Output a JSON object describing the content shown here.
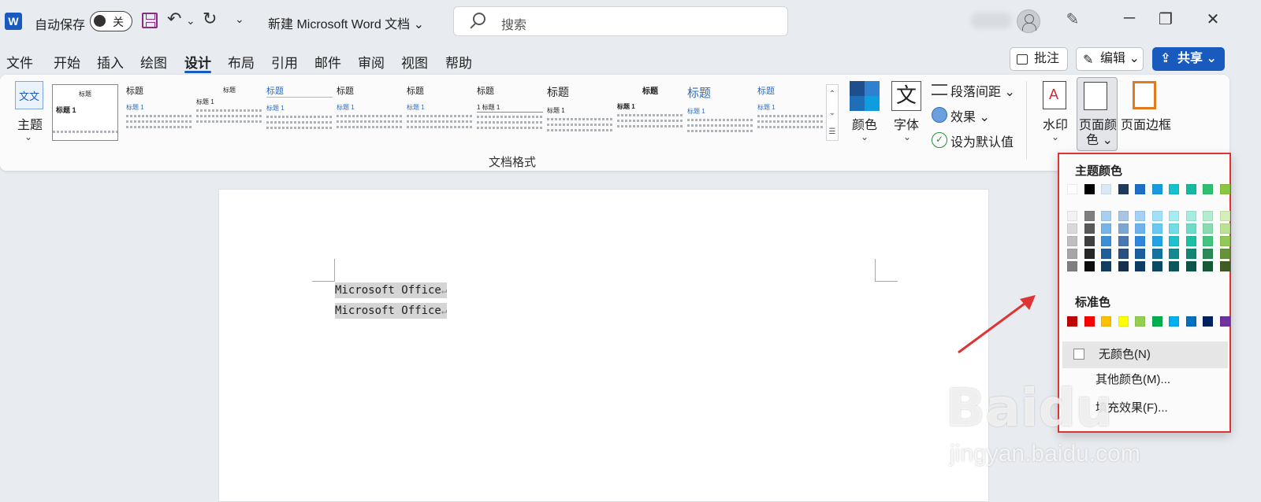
{
  "titlebar": {
    "app_logo": "W",
    "autosave_label": "自动保存",
    "autosave_state": "关",
    "save_icon": "save-icon",
    "undo_glyph": "↶",
    "undo_dropdown": "⌄",
    "redo_glyph": "↻",
    "customize_glyph": "⌄",
    "doc_title": "新建 Microsoft Word 文档 ⌄",
    "search_placeholder": "搜索",
    "window": {
      "minimize": "─",
      "restore": "❐",
      "close": "✕"
    },
    "coauthor_glyph": "✎"
  },
  "tabs": [
    "文件",
    "开始",
    "插入",
    "绘图",
    "设计",
    "布局",
    "引用",
    "邮件",
    "审阅",
    "视图",
    "帮助"
  ],
  "active_tab": "设计",
  "actions": {
    "comment": "批注",
    "edit": "编辑 ⌄",
    "share": "共享 ⌄"
  },
  "ribbon": {
    "theme": {
      "label": "主题",
      "chevron": "⌄",
      "icon_text": "文文"
    },
    "gallery": {
      "thumbs": [
        {
          "heading": "标题",
          "subheading": "标题 1"
        },
        {
          "heading": "标题",
          "subheading": "标题 1"
        },
        {
          "heading": "标题",
          "subheading": "标题 1"
        },
        {
          "heading": "标题",
          "subheading": "标题 1"
        },
        {
          "heading": "标题",
          "subheading": "标题 1"
        },
        {
          "heading": "标题",
          "subheading": "标题 1"
        },
        {
          "heading": "标题",
          "subheading": "1 标题 1"
        },
        {
          "heading": "标题",
          "subheading": "标题 1"
        },
        {
          "heading": "标题",
          "subheading": "标题 1"
        },
        {
          "heading": "标题",
          "subheading": "标题 1"
        },
        {
          "heading": "标题",
          "subheading": "标题 1"
        }
      ],
      "scroll": [
        "⌃",
        "⌄",
        "☰"
      ]
    },
    "group_label": "文档格式",
    "colors": {
      "label": "颜色",
      "chevron": "⌄"
    },
    "fonts": {
      "label": "字体",
      "icon_text": "文",
      "chevron": "⌄"
    },
    "paragraph_spacing": "段落间距 ⌄",
    "effects": "效果 ⌄",
    "set_default": "设为默认值",
    "watermark": {
      "label": "水印",
      "chevron": "⌄"
    },
    "page_color": {
      "label_top": "页面颜",
      "label_bottom": "色 ⌄"
    },
    "page_border": {
      "label": "页面边框"
    }
  },
  "document": {
    "lines": [
      "Microsoft Office",
      "Microsoft Office"
    ],
    "paragraph_mark": "↵"
  },
  "dropdown": {
    "theme_title": "主题颜色",
    "theme_top": [
      "#ffffff",
      "#000000",
      "#dbe9f7",
      "#1f3a5f",
      "#1e6fc4",
      "#1a9be0",
      "#14c2cc",
      "#15b8a0",
      "#2fbf71",
      "#8cc540"
    ],
    "theme_shades": [
      [
        "#f2f2f2",
        "#d9d9d9",
        "#bfbfbf",
        "#a6a6a6",
        "#7f7f7f"
      ],
      [
        "#7f7f7f",
        "#595959",
        "#3f3f3f",
        "#262626",
        "#0d0d0d"
      ],
      [
        "#a9cff0",
        "#77b5e8",
        "#3a8fd6",
        "#1f5f99",
        "#123d63"
      ],
      [
        "#a9c4e4",
        "#7ea6d4",
        "#4a77b4",
        "#2a4f80",
        "#17304f"
      ],
      [
        "#a6d0f5",
        "#6fb2ef",
        "#2f86dd",
        "#195e9e",
        "#0f3c66"
      ],
      [
        "#a2e0f8",
        "#69c9f1",
        "#23a3e3",
        "#14739f",
        "#0b4a67"
      ],
      [
        "#a6edf1",
        "#70dde4",
        "#1fc2cc",
        "#14898f",
        "#0b575c"
      ],
      [
        "#a4ede0",
        "#6dddc8",
        "#1bbfa2",
        "#128673",
        "#0a564a"
      ],
      [
        "#b5ebce",
        "#88dcb0",
        "#43c47f",
        "#2a8a58",
        "#175a38"
      ],
      [
        "#d7edba",
        "#bce094",
        "#93c854",
        "#65923a",
        "#3e5c23"
      ]
    ],
    "standard_title": "标准色",
    "standard": [
      "#c00000",
      "#ff0000",
      "#ffc000",
      "#ffff00",
      "#92d050",
      "#00b050",
      "#00b0f0",
      "#0070c0",
      "#002060",
      "#7030a0"
    ],
    "no_color": "无颜色(N)",
    "more_colors": "其他颜色(M)...",
    "fill_effects": "填充效果(F)..."
  },
  "watermark_overlay": {
    "brand": "Baidu",
    "url": "jingyan.baidu.com"
  },
  "accent_color": "#185abd",
  "highlight_border_color": "#e03434"
}
